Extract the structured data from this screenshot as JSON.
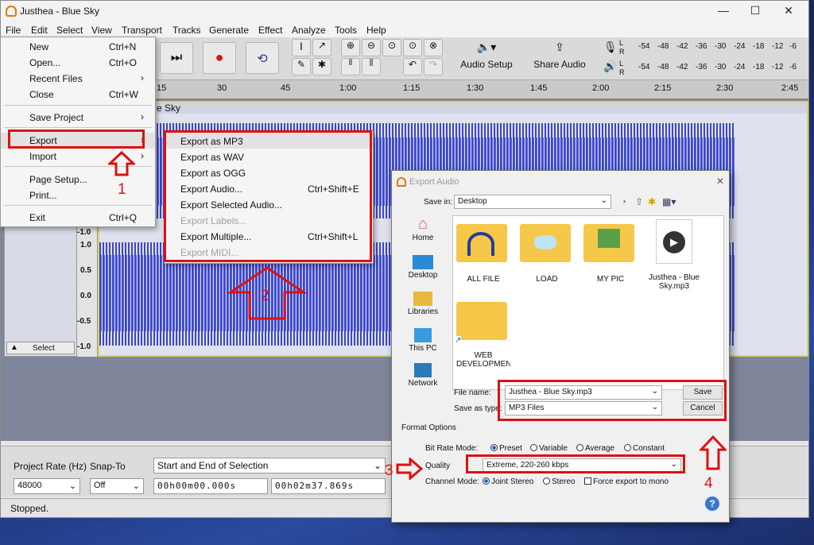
{
  "window": {
    "title": "Justhea - Blue Sky",
    "controls": [
      "—",
      "☐",
      "✕"
    ]
  },
  "menubar": [
    "File",
    "Edit",
    "Select",
    "View",
    "Transport",
    "Tracks",
    "Generate",
    "Effect",
    "Analyze",
    "Tools",
    "Help"
  ],
  "toolbar": {
    "audio_setup": "Audio Setup",
    "share_audio": "Share Audio",
    "meter_labels": [
      "-54",
      "-48",
      "-42",
      "-36",
      "-30",
      "-24",
      "-18",
      "-12",
      "-6"
    ],
    "meter_channels": [
      "L",
      "R"
    ]
  },
  "ruler": [
    "15",
    "30",
    "45",
    "1:00",
    "1:15",
    "1:30",
    "1:45",
    "2:00",
    "2:15",
    "2:30",
    "2:45"
  ],
  "track": {
    "name": "e Sky",
    "select_label": "Select",
    "scale": [
      "-1.0",
      "1.0",
      "0.5",
      "0.0",
      "-0.5",
      "-1.0"
    ]
  },
  "file_menu": [
    {
      "label": "New",
      "shortcut": "Ctrl+N"
    },
    {
      "label": "Open...",
      "shortcut": "Ctrl+O"
    },
    {
      "label": "Recent Files",
      "shortcut": "",
      "arrow": "›"
    },
    {
      "label": "Close",
      "shortcut": "Ctrl+W"
    },
    {
      "label": "Save Project",
      "shortcut": "",
      "arrow": "›"
    },
    {
      "label": "Export",
      "shortcut": "",
      "arrow": "›"
    },
    {
      "label": "Import",
      "shortcut": "",
      "arrow": "›"
    },
    {
      "label": "Page Setup...",
      "shortcut": ""
    },
    {
      "label": "Print...",
      "shortcut": ""
    },
    {
      "label": "Exit",
      "shortcut": "Ctrl+Q"
    }
  ],
  "export_submenu": [
    {
      "label": "Export as MP3",
      "shortcut": "",
      "disabled": false
    },
    {
      "label": "Export as WAV",
      "shortcut": "",
      "disabled": false
    },
    {
      "label": "Export as OGG",
      "shortcut": "",
      "disabled": false
    },
    {
      "label": "Export Audio...",
      "shortcut": "Ctrl+Shift+E",
      "disabled": false
    },
    {
      "label": "Export Selected Audio...",
      "shortcut": "",
      "disabled": false
    },
    {
      "label": "Export Labels...",
      "shortcut": "",
      "disabled": true
    },
    {
      "label": "Export Multiple...",
      "shortcut": "Ctrl+Shift+L",
      "disabled": false
    },
    {
      "label": "Export MIDI...",
      "shortcut": "",
      "disabled": true
    }
  ],
  "annotations": {
    "step1": "1",
    "step2": "2",
    "step3": "3",
    "step4": "4"
  },
  "selection_bar": {
    "project_rate_label": "Project Rate (Hz)",
    "project_rate": "48000",
    "snap_to_label": "Snap-To",
    "snap_to": "Off",
    "selection_mode": "Start and End of Selection",
    "start_time": "00h00m00.000s",
    "end_time": "00h02m37.869s"
  },
  "status": "Stopped.",
  "export_dialog": {
    "title": "Export Audio",
    "save_in_label": "Save in:",
    "save_in": "Desktop",
    "places": [
      "Home",
      "Desktop",
      "Libraries",
      "This PC",
      "Network"
    ],
    "files": [
      "ALL FILE",
      "LOAD",
      "MY PIC",
      "Justhea - Blue Sky.mp3",
      "WEB DEVELOPMENT"
    ],
    "file_name_label": "File name:",
    "file_name": "Justhea - Blue Sky.mp3",
    "save_as_type_label": "Save as type:",
    "save_as_type": "MP3 Files",
    "save_button": "Save",
    "cancel_button": "Cancel",
    "format_options": "Format Options",
    "bit_rate_mode_label": "Bit Rate Mode:",
    "bit_rate_modes": [
      "Preset",
      "Variable",
      "Average",
      "Constant"
    ],
    "quality_label": "Quality",
    "quality": "Extreme, 220-260 kbps",
    "channel_mode_label": "Channel Mode:",
    "channel_modes": [
      "Joint Stereo",
      "Stereo"
    ],
    "force_mono": "Force export to mono",
    "help": "?"
  }
}
